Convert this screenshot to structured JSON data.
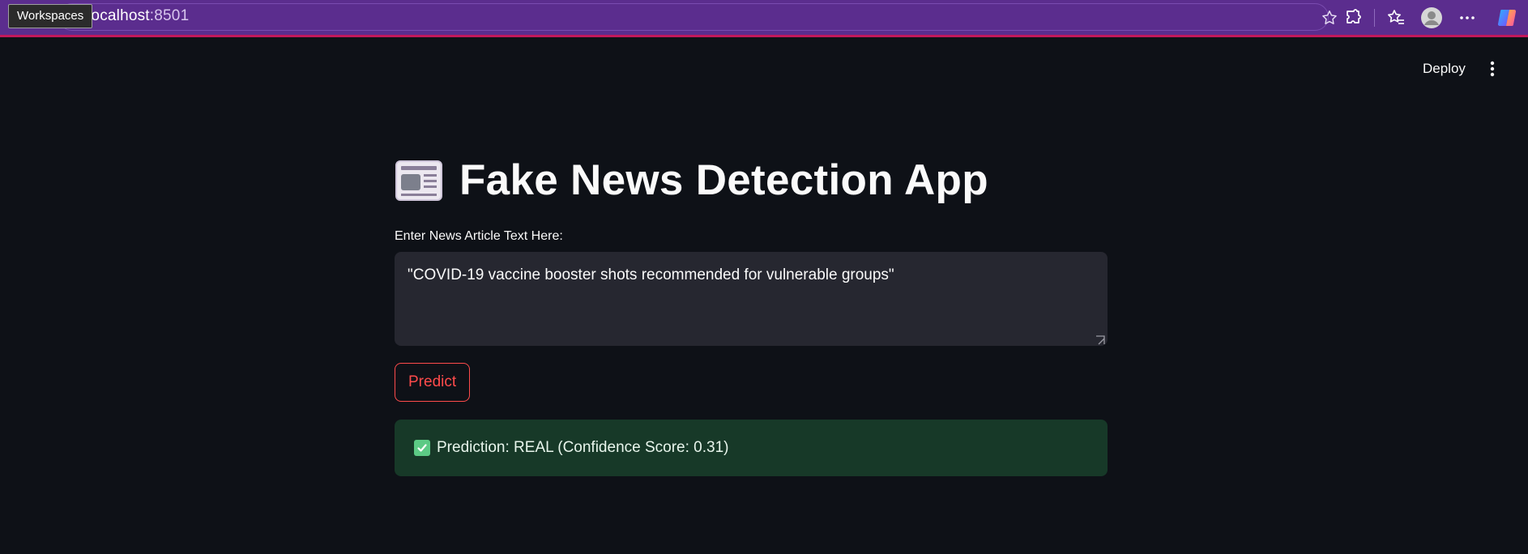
{
  "browser": {
    "url_host": "localhost",
    "url_port": ":8501",
    "workspaces_tooltip": "Workspaces",
    "icons": [
      "star-icon",
      "extensions-icon",
      "favorites-icon",
      "profile-avatar",
      "more-icon",
      "copilot-icon"
    ]
  },
  "header": {
    "deploy_label": "Deploy",
    "menu_icon": "vertical-dots-icon"
  },
  "main": {
    "title": "Fake News Detection App",
    "title_icon": "newspaper-icon",
    "input_label": "Enter News Article Text Here:",
    "input_value": "\"COVID-19 vaccine booster shots recommended for vulnerable groups\"",
    "predict_label": "Predict",
    "result_icon": "check-mark-icon",
    "result_text": "Prediction: REAL (Confidence Score: 0.31)"
  },
  "colors": {
    "background": "#0e1117",
    "browser_bar": "#5b2d8e",
    "primary": "#ff4b4b",
    "input_bg": "#262730",
    "success_bg": "#173928",
    "success_check": "#5cca85"
  }
}
